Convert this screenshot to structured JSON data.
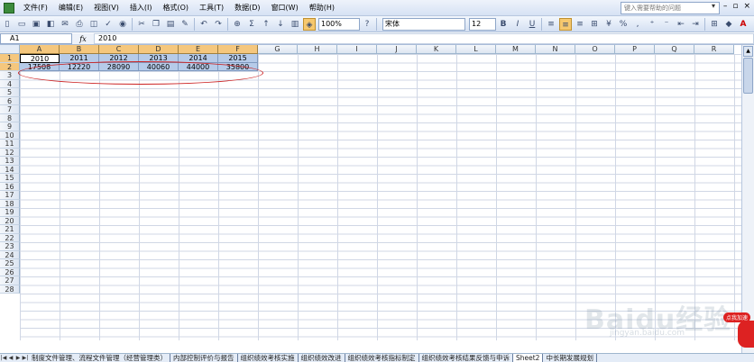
{
  "menu": {
    "items": [
      "文件(F)",
      "编辑(E)",
      "视图(V)",
      "插入(I)",
      "格式(O)",
      "工具(T)",
      "数据(D)",
      "窗口(W)",
      "帮助(H)"
    ],
    "help_placeholder": "键入需要帮助的问题"
  },
  "toolbar": {
    "zoom": "100%",
    "font_name": "宋体",
    "font_size": "12",
    "bold": "B",
    "italic": "I",
    "underline": "U",
    "percent": "%",
    "sum": "Σ"
  },
  "formula": {
    "name_box": "A1",
    "fx": "fx",
    "value": "2010"
  },
  "grid": {
    "columns": [
      "A",
      "B",
      "C",
      "D",
      "E",
      "F",
      "G",
      "H",
      "I",
      "J",
      "K",
      "L",
      "M",
      "N",
      "O",
      "P",
      "Q",
      "R"
    ],
    "rows": [
      "1",
      "2",
      "3",
      "4",
      "5",
      "6",
      "7",
      "8",
      "9",
      "10",
      "11",
      "12",
      "13",
      "14",
      "15",
      "16",
      "17",
      "18",
      "19",
      "20",
      "21",
      "22",
      "23",
      "24",
      "25",
      "26",
      "27",
      "28"
    ],
    "row1": [
      "2010",
      "2011",
      "2012",
      "2013",
      "2014",
      "2015"
    ],
    "row2": [
      "17508",
      "12220",
      "28090",
      "40060",
      "44000",
      "35800"
    ]
  },
  "sheets": {
    "tabs": [
      "制度文件管理、流程文件管理（经营管理类）",
      "内部控制评价与报告",
      "组织绩效考核实施",
      "组织绩效改进",
      "组织绩效考核指标制定",
      "组织绩效考核结果反馈与申诉",
      "Sheet2",
      "中长期发展规划"
    ],
    "active": "Sheet2"
  },
  "watermark": {
    "logo": "Baidu经验",
    "url": "jingyan.baidu.com",
    "badge": "点我加速"
  },
  "colors": {
    "accent": "#f5c77d",
    "selection": "#b6cbe9",
    "ellipse": "#cc2222"
  }
}
